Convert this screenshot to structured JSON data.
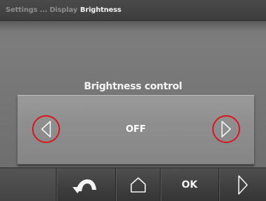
{
  "breadcrumb": {
    "path": "Settings ... Display",
    "current": "Brightness"
  },
  "control": {
    "title": "Brightness control",
    "value": "OFF"
  },
  "toolbar": {
    "ok_label": "OK",
    "icons": [
      "back-arrow-icon",
      "home-icon",
      "ok-button",
      "next-icon"
    ]
  },
  "colors": {
    "highlight_ring": "#d8161d",
    "background": "#767676",
    "bar": "#3e3e3e"
  }
}
